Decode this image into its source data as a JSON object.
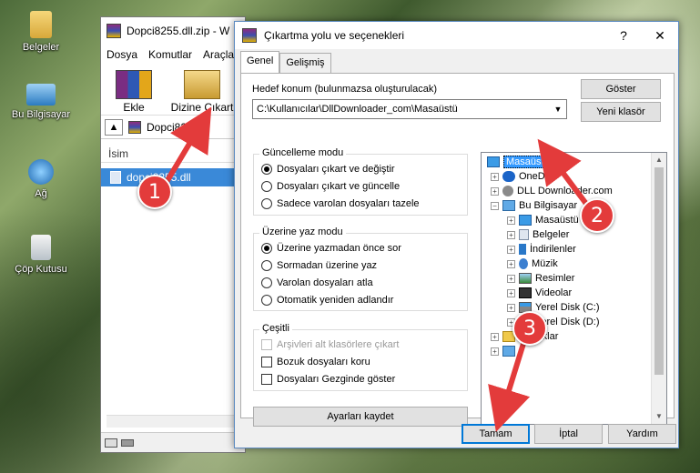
{
  "desktop": {
    "icons": [
      {
        "label": "Belgeler",
        "icon": "documents-folder-icon"
      },
      {
        "label": "Bu Bilgisayar",
        "icon": "computer-icon"
      },
      {
        "label": "Ağ",
        "icon": "network-icon"
      },
      {
        "label": "Çöp Kutusu",
        "icon": "recycle-bin-icon"
      }
    ]
  },
  "winrar": {
    "title": "Dopci8255.dll.zip - W",
    "menu": [
      "Dosya",
      "Komutlar",
      "Araçla"
    ],
    "toolbar": {
      "add_label": "Ekle",
      "extract_label": "Dizine Çıkart"
    },
    "address": "Dopci8255",
    "column_name": "İsim",
    "file_name": "dopci8255.dll"
  },
  "dialog": {
    "title": "Çıkartma yolu ve seçenekleri",
    "help_glyph": "?",
    "close_glyph": "✕",
    "tabs": [
      "Genel",
      "Gelişmiş"
    ],
    "destination_label": "Hedef konum (bulunmazsa oluşturulacak)",
    "destination_value": "C:\\Kullanıcılar\\DllDownloader_com\\Masaüstü",
    "show_button": "Göster",
    "new_folder_button": "Yeni klasör",
    "update_mode": {
      "title": "Güncelleme modu",
      "options": [
        "Dosyaları çıkart ve değiştir",
        "Dosyaları çıkart ve güncelle",
        "Sadece varolan dosyaları tazele"
      ],
      "selected": 0
    },
    "overwrite_mode": {
      "title": "Üzerine yaz modu",
      "options": [
        "Üzerine yazmadan önce sor",
        "Sormadan üzerine yaz",
        "Varolan dosyaları atla",
        "Otomatik yeniden adlandır"
      ],
      "selected": 0
    },
    "misc": {
      "title": "Çeşitli",
      "options": [
        "Arşivleri alt klasörlere çıkart",
        "Bozuk dosyaları koru",
        "Dosyaları Gezginde göster"
      ],
      "disabled_index": 0
    },
    "save_settings_button": "Ayarları kaydet",
    "tree": [
      {
        "label": "Masaüstü",
        "selected": true,
        "icon": "desktop-icon"
      },
      {
        "label": "OneDr",
        "icon": "onedrive-icon"
      },
      {
        "label": "DLL Downloader.com",
        "icon": "folder-icon"
      },
      {
        "label": "Bu Bilgisayar",
        "icon": "computer-icon"
      },
      {
        "label": "Masaüstü",
        "icon": "desktop-icon"
      },
      {
        "label": "Belgeler",
        "icon": "documents-icon"
      },
      {
        "label": "İndirilenler",
        "icon": "downloads-icon"
      },
      {
        "label": "Müzik",
        "icon": "music-icon"
      },
      {
        "label": "Resimler",
        "icon": "pictures-icon"
      },
      {
        "label": "Videolar",
        "icon": "videos-icon"
      },
      {
        "label": "Yerel Disk (C:)",
        "icon": "drive-icon"
      },
      {
        "label": "Yerel Disk (D:)",
        "icon": "drive-icon"
      },
      {
        "label": "Kü ...klar",
        "icon": "libraries-icon"
      },
      {
        "label": "",
        "icon": "network-icon"
      }
    ],
    "ok_button": "Tamam",
    "cancel_button": "İptal",
    "help_button": "Yardım"
  },
  "annotations": {
    "step1": "1",
    "step2": "2",
    "step3": "3",
    "color": "#e33b3b"
  }
}
